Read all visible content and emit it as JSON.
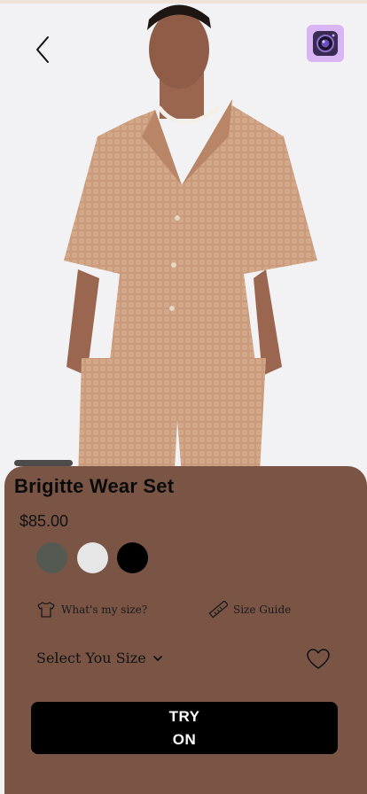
{
  "header": {
    "back_icon": "chevron-left-icon",
    "camera_icon": "camera-lens-icon"
  },
  "product": {
    "name": "Brigitte Wear Set",
    "price": "$85.00",
    "colors": [
      {
        "name": "olive-grey",
        "hex": "#545a52"
      },
      {
        "name": "light-grey",
        "hex": "#e6e6e6"
      },
      {
        "name": "black",
        "hex": "#000000"
      }
    ]
  },
  "links": {
    "whats_my_size": "What's my size?",
    "size_guide": "Size Guide"
  },
  "size_select": {
    "label": "Select You Size"
  },
  "cta": {
    "label": "TRY ON"
  },
  "theme": {
    "sheet_color": "#7a5546",
    "garment_color": "#c99a7c"
  }
}
